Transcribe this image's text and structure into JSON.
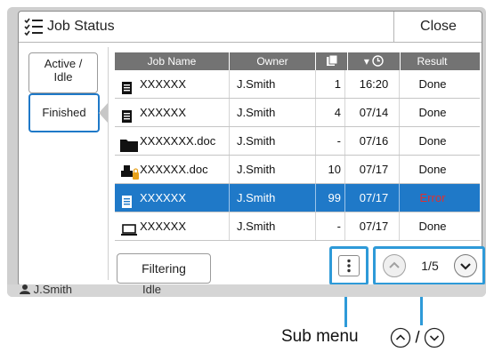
{
  "title": "Job Status",
  "close_label": "Close",
  "side_tabs": {
    "active": "Active /\nIdle",
    "finished": "Finished"
  },
  "columns": {
    "name": "Job Name",
    "owner": "Owner",
    "sort_indicator": "▾"
  },
  "jobs": [
    {
      "icon": "document-icon",
      "name": "XXXXXX",
      "owner": "J.Smith",
      "count": "1",
      "time": "16:20",
      "result": "Done"
    },
    {
      "icon": "document-icon",
      "name": "XXXXXX",
      "owner": "J.Smith",
      "count": "4",
      "time": "07/14",
      "result": "Done"
    },
    {
      "icon": "folder-icon",
      "name": "XXXXXXX.doc",
      "owner": "J.Smith",
      "count": "-",
      "time": "07/16",
      "result": "Done"
    },
    {
      "icon": "locked-print-icon",
      "name": "XXXXXX.doc",
      "owner": "J.Smith",
      "count": "10",
      "time": "07/17",
      "result": "Done"
    },
    {
      "icon": "document-icon",
      "name": "XXXXXX",
      "owner": "J.Smith",
      "count": "99",
      "time": "07/17",
      "result": "Error",
      "selected": true
    },
    {
      "icon": "computer-icon",
      "name": "XXXXXX",
      "owner": "J.Smith",
      "count": "-",
      "time": "07/17",
      "result": "Done"
    }
  ],
  "filter_label": "Filtering",
  "page": "1/5",
  "footer": {
    "user": "J.Smith",
    "status": "Idle"
  },
  "annotations": {
    "sub_menu": "Sub menu",
    "arrows_separator": "/"
  },
  "colors": {
    "accent": "#1f79c8",
    "highlight": "#2e9ad8",
    "error": "#e03030"
  }
}
